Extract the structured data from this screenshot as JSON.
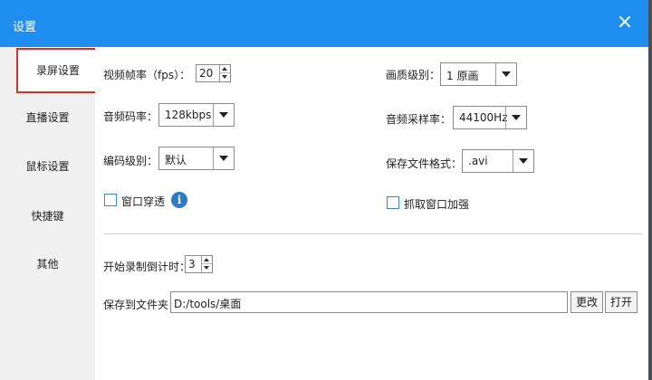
{
  "window": {
    "title": "设置"
  },
  "sidebar": {
    "items": [
      {
        "label": "录屏设置",
        "active": true
      },
      {
        "label": "直播设置"
      },
      {
        "label": "鼠标设置"
      },
      {
        "label": "快捷键"
      },
      {
        "label": "其他"
      }
    ]
  },
  "settings": {
    "fps": {
      "label": "视频帧率（fps）：",
      "value": "20"
    },
    "quality": {
      "label": "画质级别：",
      "value": "1 原画"
    },
    "audio_bitrate": {
      "label": "音频码率：",
      "value": "128kbps"
    },
    "sample_rate": {
      "label": "音频采样率：",
      "value": "44100Hz"
    },
    "encode_level": {
      "label": "编码级别：",
      "value": "默认"
    },
    "format": {
      "label": "保存文件格式：",
      "value": ".avi"
    },
    "window_through": {
      "label": "窗口穿透",
      "checked": false
    },
    "enhance_capture": {
      "label": "抓取窗口加强",
      "checked": false
    },
    "countdown": {
      "label": "开始录制倒计时：",
      "value": "3"
    },
    "save_folder": {
      "label": "保存到文件夹：",
      "value": "D:/tools/桌面"
    }
  },
  "buttons": {
    "change": "更改",
    "open": "打开"
  },
  "icons": {
    "close": "close-icon",
    "info": "info-icon"
  },
  "colors": {
    "titlebar": "#1e8ff0",
    "active_border": "#e02b2b"
  }
}
